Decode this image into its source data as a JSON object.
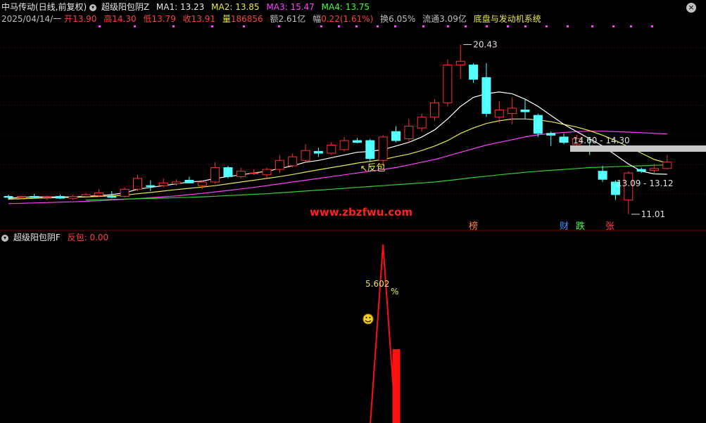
{
  "header": {
    "title": "中马传动(日线,前复权)",
    "indicator_name": "超级阳包阴Z",
    "ma1_label": "MA1: 13.23",
    "ma2_label": "MA2: 13.85",
    "ma3_label": "MA3: 15.47",
    "ma4_label": "MA4: 13.75",
    "date": "2025/04/14/一",
    "open_label": "开",
    "open": "13.90",
    "high_label": "高",
    "high": "14.30",
    "low_label": "低",
    "low": "13.79",
    "close_label": "收",
    "close": "13.91",
    "volume_label": "量",
    "volume": "186856",
    "amount_label": "额",
    "amount": "2.61亿",
    "change_label": "幅",
    "change": "0.22(1.61%)",
    "turnover_label": "换",
    "turnover": "6.05%",
    "float_label": "流通",
    "float": "3.09亿",
    "extra": "底盘与发动机系统"
  },
  "sub_header": {
    "indicator_name": "超级阳包阴F",
    "signal_label": "反包:",
    "signal_value": "0.00"
  },
  "colors": {
    "up": "#ff3030",
    "down": "#54ffff",
    "ma1": "#ffffff",
    "ma2": "#e8e84a",
    "ma3": "#ff40ff",
    "ma4": "#30d030",
    "signal": "#ff1010",
    "band": "#c8c8c8",
    "watermark": "#ff2020",
    "dot": "#ff40ff"
  },
  "annotations": {
    "high_price": "20.43",
    "low_price": "11.01",
    "band_upper": "14.60 - 14.30",
    "band_lower": "13.09 - 13.12",
    "fanbao": "反包",
    "watermark": "www.zbzfwu.com",
    "tag_bang": "榜",
    "tag_cai": "财",
    "tag_die": "跌",
    "tag_zhang": "张",
    "sub_value": "5.602",
    "sub_unit": "%",
    "sub_icon": "smiley-icon"
  },
  "chart_data": {
    "type": "candlestick",
    "candles": [
      [
        12.0,
        12.1,
        11.8,
        11.95
      ],
      [
        11.95,
        12.05,
        11.85,
        12.0
      ],
      [
        12.0,
        12.15,
        11.9,
        11.95
      ],
      [
        11.95,
        12.05,
        11.8,
        12.0
      ],
      [
        12.0,
        12.1,
        11.85,
        11.9
      ],
      [
        11.9,
        12.1,
        11.8,
        12.0
      ],
      [
        12.0,
        12.2,
        11.9,
        12.1
      ],
      [
        12.05,
        12.4,
        11.95,
        12.2
      ],
      [
        12.0,
        12.3,
        11.9,
        11.95
      ],
      [
        12.0,
        12.5,
        11.95,
        12.4
      ],
      [
        12.4,
        13.2,
        12.3,
        13.0
      ],
      [
        12.6,
        12.9,
        12.3,
        12.55
      ],
      [
        12.6,
        13.0,
        12.5,
        12.75
      ],
      [
        12.7,
        12.95,
        12.6,
        12.8
      ],
      [
        12.9,
        13.1,
        12.8,
        12.75
      ],
      [
        12.6,
        12.9,
        12.4,
        12.8
      ],
      [
        12.8,
        13.9,
        12.7,
        13.6
      ],
      [
        13.6,
        13.7,
        13.0,
        13.1
      ],
      [
        13.1,
        13.6,
        13.0,
        13.4
      ],
      [
        13.3,
        13.5,
        13.2,
        13.3
      ],
      [
        13.2,
        13.6,
        13.0,
        13.5
      ],
      [
        13.5,
        14.3,
        13.3,
        14.0
      ],
      [
        13.7,
        14.4,
        13.6,
        14.2
      ],
      [
        14.0,
        14.9,
        13.9,
        14.55
      ],
      [
        14.5,
        14.7,
        14.2,
        14.4
      ],
      [
        14.4,
        15.0,
        14.3,
        14.85
      ],
      [
        14.6,
        15.3,
        14.5,
        15.1
      ],
      [
        15.1,
        15.25,
        14.95,
        15.0
      ],
      [
        15.1,
        15.2,
        13.9,
        14.1
      ],
      [
        14.0,
        15.4,
        13.7,
        15.3
      ],
      [
        15.6,
        15.9,
        15.0,
        15.1
      ],
      [
        15.2,
        16.3,
        15.0,
        15.9
      ],
      [
        15.8,
        16.6,
        15.6,
        16.4
      ],
      [
        16.4,
        17.4,
        16.2,
        17.2
      ],
      [
        17.2,
        19.6,
        17.0,
        19.3
      ],
      [
        19.3,
        20.43,
        18.5,
        19.5
      ],
      [
        19.3,
        19.4,
        18.3,
        18.5
      ],
      [
        18.6,
        19.4,
        16.4,
        16.6
      ],
      [
        16.4,
        17.3,
        16.1,
        16.8
      ],
      [
        16.6,
        17.5,
        16.0,
        16.9
      ],
      [
        16.8,
        17.4,
        16.3,
        16.7
      ],
      [
        16.5,
        16.6,
        15.3,
        15.5
      ],
      [
        15.5,
        15.6,
        14.8,
        15.4
      ],
      [
        15.3,
        15.5,
        14.9,
        15.0
      ],
      [
        14.9,
        15.4,
        14.7,
        15.2
      ],
      [
        14.6,
        15.3,
        14.3,
        14.5
      ],
      [
        13.4,
        13.7,
        12.8,
        12.95
      ],
      [
        12.8,
        12.9,
        11.8,
        12.1
      ],
      [
        11.8,
        13.4,
        11.01,
        13.3
      ],
      [
        13.5,
        13.6,
        13.3,
        13.4
      ],
      [
        13.45,
        13.8,
        13.3,
        13.55
      ],
      [
        13.55,
        14.3,
        13.5,
        13.91
      ]
    ],
    "ma1": [
      11.9,
      11.95,
      11.98,
      11.97,
      11.98,
      11.97,
      12.0,
      12.05,
      12.1,
      12.2,
      12.4,
      12.5,
      12.6,
      12.7,
      12.8,
      12.85,
      13.0,
      13.1,
      13.2,
      13.3,
      13.4,
      13.55,
      13.7,
      13.9,
      14.0,
      14.15,
      14.3,
      14.45,
      14.5,
      14.6,
      14.8,
      15.0,
      15.3,
      15.7,
      16.3,
      17.0,
      17.5,
      17.7,
      17.8,
      17.7,
      17.4,
      17.0,
      16.5,
      16.0,
      15.6,
      15.2,
      14.8,
      14.3,
      13.8,
      13.4,
      13.25,
      13.23
    ],
    "ma2": [
      11.85,
      11.87,
      11.9,
      11.92,
      11.93,
      11.95,
      11.97,
      12.0,
      12.03,
      12.07,
      12.15,
      12.22,
      12.3,
      12.38,
      12.45,
      12.52,
      12.6,
      12.7,
      12.8,
      12.9,
      13.0,
      13.1,
      13.22,
      13.35,
      13.48,
      13.6,
      13.72,
      13.85,
      13.95,
      14.05,
      14.2,
      14.35,
      14.55,
      14.8,
      15.1,
      15.5,
      15.8,
      16.05,
      16.2,
      16.3,
      16.3,
      16.25,
      16.15,
      16.0,
      15.85,
      15.65,
      15.4,
      15.1,
      14.75,
      14.4,
      14.05,
      13.85
    ],
    "ma3": [
      11.6,
      11.62,
      11.64,
      11.66,
      11.68,
      11.7,
      11.73,
      11.76,
      11.8,
      11.84,
      11.88,
      11.93,
      11.98,
      12.03,
      12.1,
      12.17,
      12.25,
      12.33,
      12.42,
      12.5,
      12.6,
      12.7,
      12.8,
      12.9,
      13.0,
      13.1,
      13.2,
      13.3,
      13.4,
      13.5,
      13.6,
      13.75,
      13.9,
      14.05,
      14.25,
      14.45,
      14.65,
      14.85,
      15.0,
      15.15,
      15.3,
      15.42,
      15.5,
      15.55,
      15.6,
      15.62,
      15.62,
      15.6,
      15.57,
      15.54,
      15.5,
      15.47
    ],
    "ma4": [
      null,
      null,
      null,
      null,
      null,
      null,
      11.8,
      11.82,
      11.83,
      11.85,
      11.87,
      11.89,
      11.91,
      11.93,
      11.95,
      11.98,
      12.01,
      12.05,
      12.08,
      12.12,
      12.15,
      12.2,
      12.25,
      12.3,
      12.35,
      12.4,
      12.45,
      12.5,
      12.55,
      12.6,
      12.65,
      12.7,
      12.75,
      12.8,
      12.88,
      12.96,
      13.05,
      13.12,
      13.2,
      13.27,
      13.34,
      13.4,
      13.45,
      13.5,
      13.55,
      13.6,
      13.63,
      13.65,
      13.68,
      13.7,
      13.73,
      13.75
    ],
    "ylim": [
      10.5,
      21.5
    ],
    "signal_sub": {
      "type": "line+bar",
      "spike_index": 29,
      "spike_value": 5.602,
      "bar_index": 30
    }
  }
}
